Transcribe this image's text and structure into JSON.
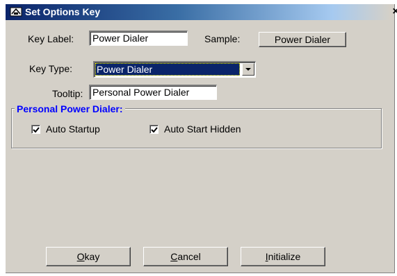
{
  "window": {
    "title": "Set Options Key",
    "close_label": "×"
  },
  "form": {
    "key_label": {
      "label": "Key Label:",
      "value": "Power Dialer"
    },
    "sample": {
      "label": "Sample:",
      "button_label": "Power Dialer"
    },
    "key_type": {
      "label": "Key Type:",
      "selected": "Power Dialer"
    },
    "tooltip": {
      "label": "Tooltip:",
      "value": "Personal Power Dialer"
    }
  },
  "group": {
    "title": "Personal Power Dialer:",
    "title_color": "#0000ff",
    "options": [
      {
        "label": "Auto Startup",
        "checked": true
      },
      {
        "label": "Auto Start Hidden",
        "checked": true
      }
    ]
  },
  "buttons": {
    "okay": {
      "mnemonic": "O",
      "rest": "kay"
    },
    "cancel": {
      "mnemonic": "C",
      "rest": "ancel"
    },
    "initialize": {
      "mnemonic": "I",
      "rest": "nitialize"
    }
  },
  "icons": {
    "title": "app-icon",
    "combo": "chevron-down-icon",
    "check": "checkmark-icon"
  }
}
